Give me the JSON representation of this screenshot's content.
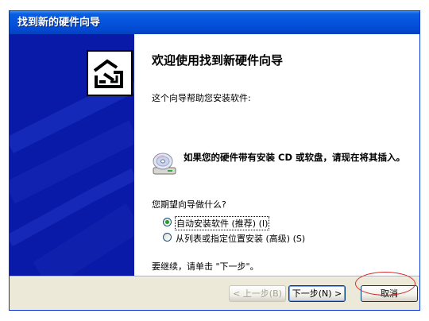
{
  "window": {
    "title": "找到新的硬件向导"
  },
  "main": {
    "heading": "欢迎使用找到新硬件向导",
    "intro": "这个向导帮助您安装软件:",
    "cd_notice": "如果您的硬件带有安装 CD 或软盘，请现在将其插入。",
    "question": "您期望向导做什么?",
    "options": [
      {
        "label": "自动安装软件 (推荐) (I)",
        "selected": true
      },
      {
        "label": "从列表或指定位置安装 (高级) (S)",
        "selected": false
      }
    ],
    "continue_text": "要继续，请单击 \"下一步\"。"
  },
  "buttons": {
    "back": "< 上一步(B)",
    "next": "下一步(N) >",
    "cancel": "取消"
  },
  "icons": {
    "banner": "hardware-install-icon",
    "cd": "cd-disk-icon",
    "radio_selected": "radio-selected-icon"
  },
  "colors": {
    "titlebar": "#0553dc",
    "banner": "#0a1aa8",
    "window_bg": "#ece9d8",
    "annotation": "#d33030"
  }
}
